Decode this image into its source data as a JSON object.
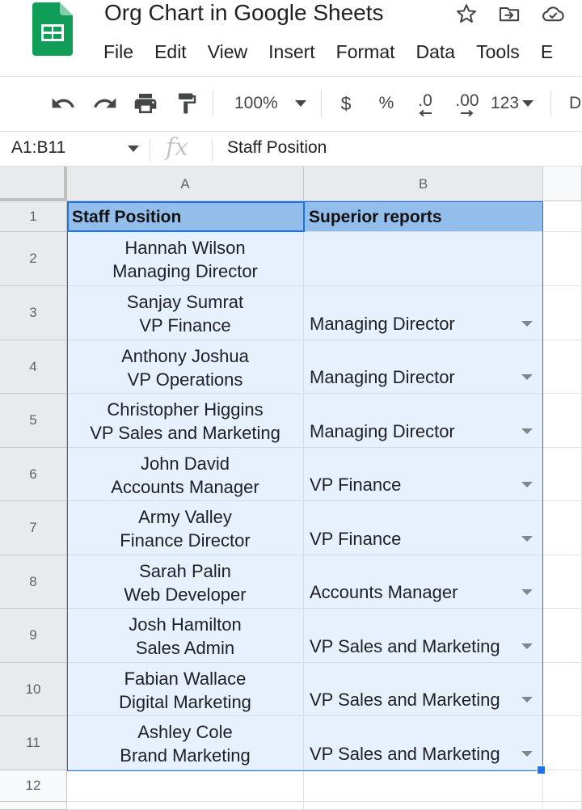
{
  "document": {
    "title": "Org Chart in Google Sheets"
  },
  "menu": [
    "File",
    "Edit",
    "View",
    "Insert",
    "Format",
    "Data",
    "Tools",
    "E"
  ],
  "toolbar": {
    "zoom": "100%",
    "currency": "$",
    "percent": "%",
    "decrease_decimal": ".0",
    "increase_decimal": ".00",
    "more_formats": "123",
    "font_partial": "D"
  },
  "formula_bar": {
    "cell_range": "A1:B11",
    "fx": "fx",
    "content": "Staff Position"
  },
  "columns": [
    "A",
    "B"
  ],
  "rows": [
    {
      "num": "1",
      "a1": "Staff Position",
      "b": "Superior reports"
    },
    {
      "num": "2",
      "a1": "Hannah Wilson",
      "a2": "Managing Director",
      "b": ""
    },
    {
      "num": "3",
      "a1": "Sanjay Sumrat",
      "a2": "VP Finance",
      "b": "Managing Director"
    },
    {
      "num": "4",
      "a1": "Anthony Joshua",
      "a2": "VP Operations",
      "b": "Managing Director"
    },
    {
      "num": "5",
      "a1": "Christopher Higgins",
      "a2": "VP Sales and Marketing",
      "b": "Managing Director"
    },
    {
      "num": "6",
      "a1": "John David",
      "a2": "Accounts Manager",
      "b": "VP Finance"
    },
    {
      "num": "7",
      "a1": "Army Valley",
      "a2": "Finance Director",
      "b": "VP Finance"
    },
    {
      "num": "8",
      "a1": "Sarah Palin",
      "a2": "Web Developer",
      "b": "Accounts Manager"
    },
    {
      "num": "9",
      "a1": "Josh Hamilton",
      "a2": "Sales Admin",
      "b": "VP Sales and Marketing"
    },
    {
      "num": "10",
      "a1": "Fabian Wallace",
      "a2": "Digital Marketing",
      "b": "VP Sales and Marketing"
    },
    {
      "num": "11",
      "a1": "Ashley Cole",
      "a2": "Brand Marketing",
      "b": "VP Sales and Marketing"
    },
    {
      "num": "12"
    }
  ],
  "colors": {
    "header_fill": "#93bdea",
    "body_fill": "#e7f0fd",
    "selection": "#1a73e8",
    "brand_green": "#0f9d58"
  }
}
